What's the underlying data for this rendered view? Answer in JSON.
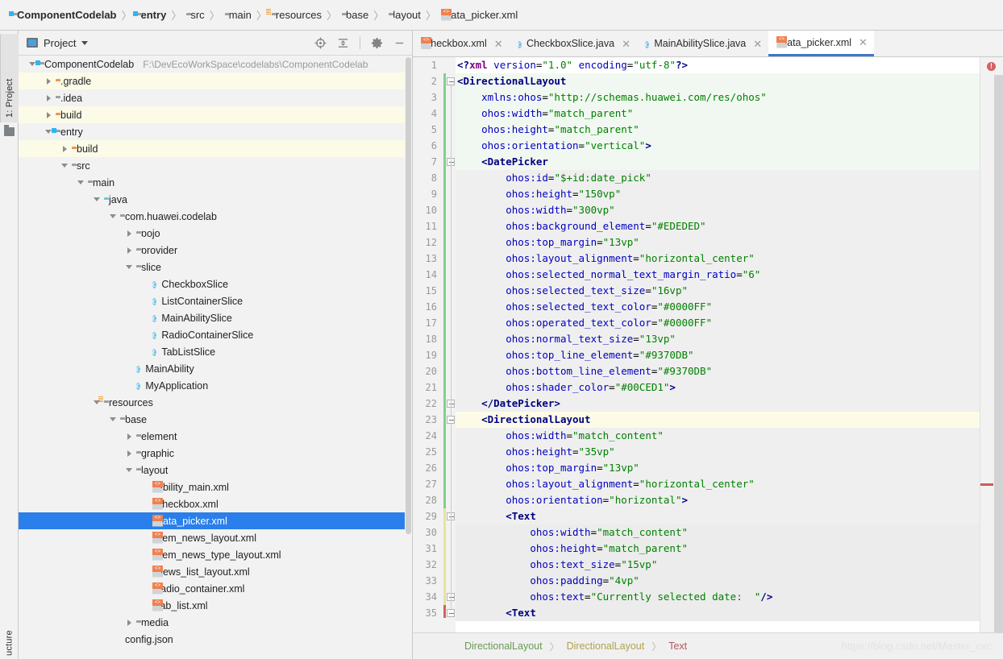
{
  "window": {
    "breadcrumb": [
      {
        "label": "ComponentCodelab",
        "icon": "module-folder-icon",
        "bold": true
      },
      {
        "label": "entry",
        "icon": "module-folder-icon",
        "bold": true
      },
      {
        "label": "src",
        "icon": "folder-icon",
        "bold": false
      },
      {
        "label": "main",
        "icon": "folder-icon",
        "bold": false
      },
      {
        "label": "resources",
        "icon": "resources-folder-icon",
        "bold": false
      },
      {
        "label": "base",
        "icon": "package-icon",
        "bold": false
      },
      {
        "label": "layout",
        "icon": "package-icon",
        "bold": false
      },
      {
        "label": "data_picker.xml",
        "icon": "xml-file-icon",
        "bold": false
      }
    ],
    "separator": "〉"
  },
  "toolstrip": {
    "project_tab": "1: Project",
    "structure_tab": "ucture"
  },
  "project_panel": {
    "title": "Project",
    "actions": [
      {
        "name": "locate-icon",
        "label": "Select Opened File"
      },
      {
        "name": "collapse-all-icon",
        "label": "Collapse All"
      },
      {
        "name": "gear-icon",
        "label": "Settings"
      },
      {
        "name": "minimize-icon",
        "label": "Hide"
      }
    ],
    "tree": [
      {
        "label": "ComponentCodelab",
        "path": "F:\\DevEcoWorkSpace\\codelabs\\ComponentCodelab",
        "indent": 0,
        "arrow": "down",
        "icon": "module-folder-icon",
        "row": "plain"
      },
      {
        "label": ".gradle",
        "path": "",
        "indent": 1,
        "arrow": "right",
        "icon": "folder-orange-icon",
        "row": "alt"
      },
      {
        "label": ".idea",
        "path": "",
        "indent": 1,
        "arrow": "right",
        "icon": "folder-icon",
        "row": "plain"
      },
      {
        "label": "build",
        "path": "",
        "indent": 1,
        "arrow": "right",
        "icon": "folder-orange-icon",
        "row": "alt"
      },
      {
        "label": "entry",
        "path": "",
        "indent": 1,
        "arrow": "down",
        "icon": "module-folder-icon",
        "row": "plain"
      },
      {
        "label": "build",
        "path": "",
        "indent": 2,
        "arrow": "right",
        "icon": "folder-orange-icon",
        "row": "alt"
      },
      {
        "label": "src",
        "path": "",
        "indent": 2,
        "arrow": "down",
        "icon": "folder-icon",
        "row": "plain"
      },
      {
        "label": "main",
        "path": "",
        "indent": 3,
        "arrow": "down",
        "icon": "folder-icon",
        "row": "plain"
      },
      {
        "label": "java",
        "path": "",
        "indent": 4,
        "arrow": "down",
        "icon": "folder-blue-icon",
        "row": "plain"
      },
      {
        "label": "com.huawei.codelab",
        "path": "",
        "indent": 5,
        "arrow": "down",
        "icon": "package-icon",
        "row": "plain"
      },
      {
        "label": "pojo",
        "path": "",
        "indent": 6,
        "arrow": "right",
        "icon": "package-icon",
        "row": "plain"
      },
      {
        "label": "provider",
        "path": "",
        "indent": 6,
        "arrow": "right",
        "icon": "package-icon",
        "row": "plain"
      },
      {
        "label": "slice",
        "path": "",
        "indent": 6,
        "arrow": "down",
        "icon": "package-icon",
        "row": "plain"
      },
      {
        "label": "CheckboxSlice",
        "path": "",
        "indent": 7,
        "arrow": "none",
        "icon": "java-class-icon",
        "row": "plain"
      },
      {
        "label": "ListContainerSlice",
        "path": "",
        "indent": 7,
        "arrow": "none",
        "icon": "java-class-icon",
        "row": "plain"
      },
      {
        "label": "MainAbilitySlice",
        "path": "",
        "indent": 7,
        "arrow": "none",
        "icon": "java-class-icon",
        "row": "plain"
      },
      {
        "label": "RadioContainerSlice",
        "path": "",
        "indent": 7,
        "arrow": "none",
        "icon": "java-class-icon",
        "row": "plain"
      },
      {
        "label": "TabListSlice",
        "path": "",
        "indent": 7,
        "arrow": "none",
        "icon": "java-class-icon",
        "row": "plain"
      },
      {
        "label": "MainAbility",
        "path": "",
        "indent": 6,
        "arrow": "none",
        "icon": "java-class-icon",
        "row": "plain"
      },
      {
        "label": "MyApplication",
        "path": "",
        "indent": 6,
        "arrow": "none",
        "icon": "java-class-icon",
        "row": "plain"
      },
      {
        "label": "resources",
        "path": "",
        "indent": 4,
        "arrow": "down",
        "icon": "resources-folder-icon",
        "row": "plain"
      },
      {
        "label": "base",
        "path": "",
        "indent": 5,
        "arrow": "down",
        "icon": "package-icon",
        "row": "plain"
      },
      {
        "label": "element",
        "path": "",
        "indent": 6,
        "arrow": "right",
        "icon": "package-icon",
        "row": "plain"
      },
      {
        "label": "graphic",
        "path": "",
        "indent": 6,
        "arrow": "right",
        "icon": "package-icon",
        "row": "plain"
      },
      {
        "label": "layout",
        "path": "",
        "indent": 6,
        "arrow": "down",
        "icon": "package-icon",
        "row": "plain"
      },
      {
        "label": "ability_main.xml",
        "path": "",
        "indent": 7,
        "arrow": "none",
        "icon": "xml-file-icon",
        "row": "plain"
      },
      {
        "label": "checkbox.xml",
        "path": "",
        "indent": 7,
        "arrow": "none",
        "icon": "xml-file-icon",
        "row": "plain"
      },
      {
        "label": "data_picker.xml",
        "path": "",
        "indent": 7,
        "arrow": "none",
        "icon": "xml-file-icon",
        "row": "sel"
      },
      {
        "label": "item_news_layout.xml",
        "path": "",
        "indent": 7,
        "arrow": "none",
        "icon": "xml-file-icon",
        "row": "plain"
      },
      {
        "label": "item_news_type_layout.xml",
        "path": "",
        "indent": 7,
        "arrow": "none",
        "icon": "xml-file-icon",
        "row": "plain"
      },
      {
        "label": "news_list_layout.xml",
        "path": "",
        "indent": 7,
        "arrow": "none",
        "icon": "xml-file-icon",
        "row": "plain"
      },
      {
        "label": "radio_container.xml",
        "path": "",
        "indent": 7,
        "arrow": "none",
        "icon": "xml-file-icon",
        "row": "plain"
      },
      {
        "label": "tab_list.xml",
        "path": "",
        "indent": 7,
        "arrow": "none",
        "icon": "xml-file-icon",
        "row": "plain"
      },
      {
        "label": "media",
        "path": "",
        "indent": 6,
        "arrow": "right",
        "icon": "package-icon",
        "row": "plain"
      },
      {
        "label": "config.json",
        "path": "",
        "indent": 5,
        "arrow": "none",
        "icon": "json-file-icon",
        "row": "plain"
      }
    ]
  },
  "editor": {
    "tabs": [
      {
        "label": "checkbox.xml",
        "icon": "xml-file-icon",
        "active": false
      },
      {
        "label": "CheckboxSlice.java",
        "icon": "java-class-icon",
        "active": false
      },
      {
        "label": "MainAbilitySlice.java",
        "icon": "java-class-icon",
        "active": false
      },
      {
        "label": "data_picker.xml",
        "icon": "xml-file-icon",
        "active": true
      }
    ],
    "close_glyph": "✕",
    "error_badge": "!",
    "lines": [
      {
        "n": "1",
        "text": "<?xml version=\"1.0\" encoding=\"utf-8\"?>"
      },
      {
        "n": "2",
        "text": "<DirectionalLayout"
      },
      {
        "n": "3",
        "text": "    xmlns:ohos=\"http://schemas.huawei.com/res/ohos\""
      },
      {
        "n": "4",
        "text": "    ohos:width=\"match_parent\""
      },
      {
        "n": "5",
        "text": "    ohos:height=\"match_parent\""
      },
      {
        "n": "6",
        "text": "    ohos:orientation=\"vertical\">"
      },
      {
        "n": "7",
        "text": "    <DatePicker"
      },
      {
        "n": "8",
        "text": "        ohos:id=\"$+id:date_pick\""
      },
      {
        "n": "9",
        "text": "        ohos:height=\"150vp\""
      },
      {
        "n": "10",
        "text": "        ohos:width=\"300vp\""
      },
      {
        "n": "11",
        "text": "        ohos:background_element=\"#EDEDED\""
      },
      {
        "n": "12",
        "text": "        ohos:top_margin=\"13vp\""
      },
      {
        "n": "13",
        "text": "        ohos:layout_alignment=\"horizontal_center\""
      },
      {
        "n": "14",
        "text": "        ohos:selected_normal_text_margin_ratio=\"6\""
      },
      {
        "n": "15",
        "text": "        ohos:selected_text_size=\"16vp\""
      },
      {
        "n": "16",
        "text": "        ohos:selected_text_color=\"#0000FF\""
      },
      {
        "n": "17",
        "text": "        ohos:operated_text_color=\"#0000FF\""
      },
      {
        "n": "18",
        "text": "        ohos:normal_text_size=\"13vp\""
      },
      {
        "n": "19",
        "text": "        ohos:top_line_element=\"#9370DB\""
      },
      {
        "n": "20",
        "text": "        ohos:bottom_line_element=\"#9370DB\""
      },
      {
        "n": "21",
        "text": "        ohos:shader_color=\"#00CED1\">"
      },
      {
        "n": "22",
        "text": "    </DatePicker>"
      },
      {
        "n": "23",
        "text": "    <DirectionalLayout"
      },
      {
        "n": "24",
        "text": "        ohos:width=\"match_content\""
      },
      {
        "n": "25",
        "text": "        ohos:height=\"35vp\""
      },
      {
        "n": "26",
        "text": "        ohos:top_margin=\"13vp\""
      },
      {
        "n": "27",
        "text": "        ohos:layout_alignment=\"horizontal_center\""
      },
      {
        "n": "28",
        "text": "        ohos:orientation=\"horizontal\">"
      },
      {
        "n": "29",
        "text": "        <Text"
      },
      {
        "n": "30",
        "text": "            ohos:width=\"match_content\""
      },
      {
        "n": "31",
        "text": "            ohos:height=\"match_parent\""
      },
      {
        "n": "32",
        "text": "            ohos:text_size=\"15vp\""
      },
      {
        "n": "33",
        "text": "            ohos:padding=\"4vp\""
      },
      {
        "n": "34",
        "text": "            ohos:text=\"Currently selected date:  \"/>"
      },
      {
        "n": "35",
        "text": "        <Text"
      }
    ],
    "breadcrumb": [
      {
        "label": "DirectionalLayout",
        "color": "#6a9a55"
      },
      {
        "label": "DirectionalLayout",
        "color": "#b0a24f"
      },
      {
        "label": "Text",
        "color": "#b0575f"
      }
    ],
    "breadcrumb_sep": "〉",
    "watermark": "https://blog.csdn.net/Master_cxc"
  },
  "colors": {
    "accent": "#2a7fea",
    "tag": "#000080",
    "attr": "#0000c0",
    "string": "#008000",
    "active_tab_underline": "#3c78c8",
    "error": "#d4615e",
    "tree_alt_row": "#fbfbe8"
  }
}
